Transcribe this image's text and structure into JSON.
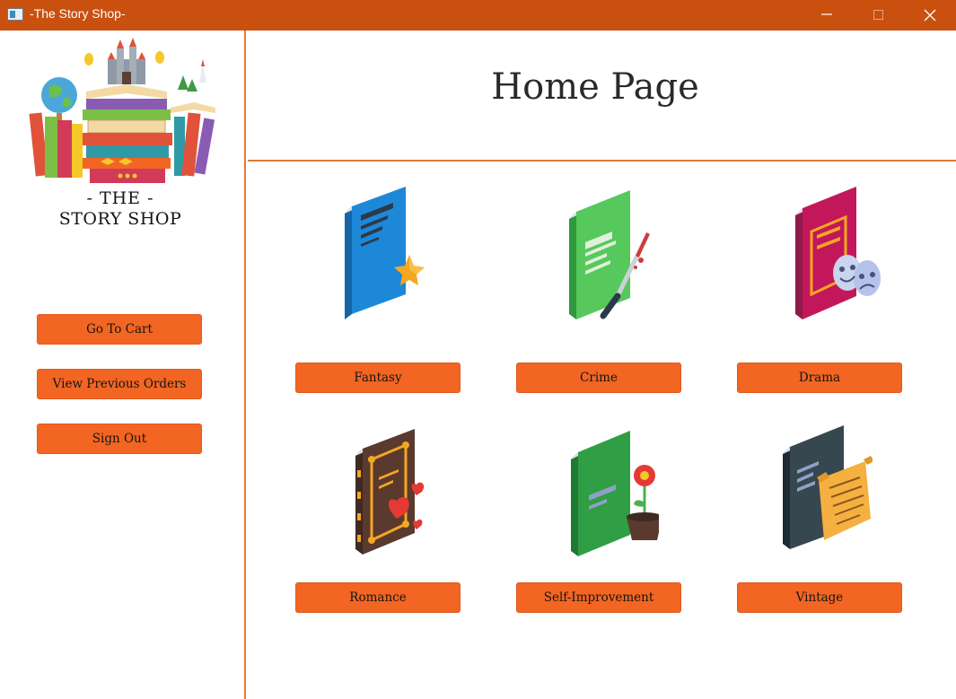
{
  "window": {
    "title": "-The Story Shop-",
    "controls": [
      "minimize",
      "maximize",
      "close"
    ]
  },
  "sidebar": {
    "logo": {
      "line1": "- THE -",
      "line2": "STORY SHOP"
    },
    "buttons": [
      "Go To Cart",
      "View Previous Orders",
      "Sign Out"
    ]
  },
  "main": {
    "title": "Home Page",
    "genres": [
      {
        "label": "Fantasy",
        "icon": "fantasy-book-icon"
      },
      {
        "label": "Crime",
        "icon": "crime-book-icon"
      },
      {
        "label": "Drama",
        "icon": "drama-book-icon"
      },
      {
        "label": "Romance",
        "icon": "romance-book-icon"
      },
      {
        "label": "Self-Improvement",
        "icon": "self-improvement-book-icon"
      },
      {
        "label": "Vintage",
        "icon": "vintage-book-icon"
      }
    ]
  },
  "colors": {
    "titlebar": "#c9500f",
    "button": "#f26522",
    "divider": "#e07a3c"
  }
}
